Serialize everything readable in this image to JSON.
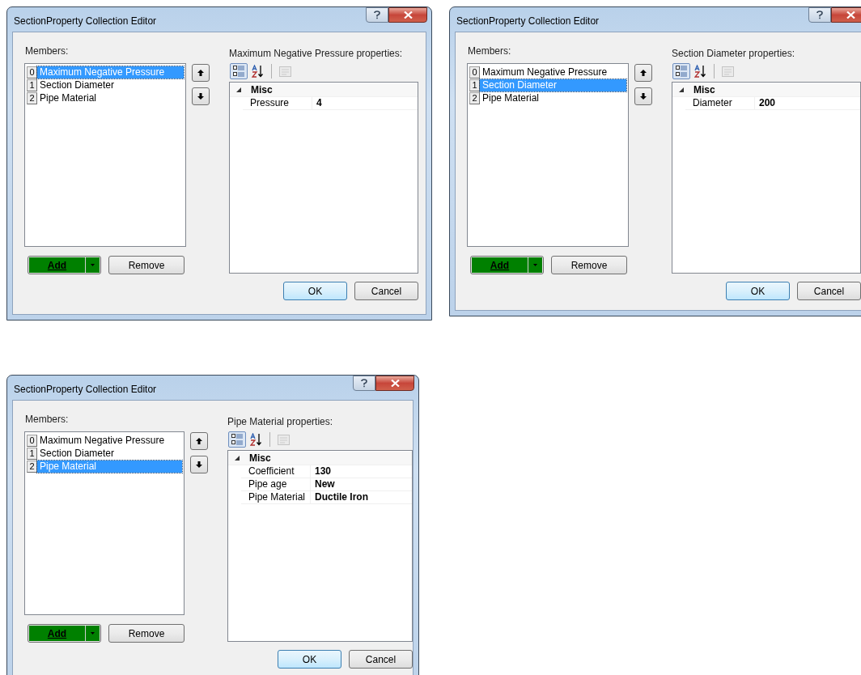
{
  "windows": [
    {
      "title": "SectionProperty Collection Editor",
      "members_label": "Members:",
      "members": [
        {
          "index": "0",
          "name": "Maximum Negative Pressure",
          "selected": true
        },
        {
          "index": "1",
          "name": "Section Diameter",
          "selected": false
        },
        {
          "index": "2",
          "name": "Pipe Material",
          "selected": false
        }
      ],
      "properties_label": "Maximum Negative Pressure properties:",
      "grid": {
        "category": "Misc",
        "expanded": true,
        "rows": [
          {
            "name": "Pressure",
            "value": "4"
          }
        ]
      },
      "add_button": "Add",
      "remove_button": "Remove",
      "ok_button": "OK",
      "cancel_button": "Cancel"
    },
    {
      "title": "SectionProperty Collection Editor",
      "members_label": "Members:",
      "members": [
        {
          "index": "0",
          "name": "Maximum Negative Pressure",
          "selected": false
        },
        {
          "index": "1",
          "name": "Section Diameter",
          "selected": true
        },
        {
          "index": "2",
          "name": "Pipe Material",
          "selected": false
        }
      ],
      "properties_label": "Section Diameter properties:",
      "grid": {
        "category": "Misc",
        "expanded": true,
        "rows": [
          {
            "name": "Diameter",
            "value": "200"
          }
        ]
      },
      "add_button": "Add",
      "remove_button": "Remove",
      "ok_button": "OK",
      "cancel_button": "Cancel"
    },
    {
      "title": "SectionProperty Collection Editor",
      "members_label": "Members:",
      "members": [
        {
          "index": "0",
          "name": "Maximum Negative Pressure",
          "selected": false
        },
        {
          "index": "1",
          "name": "Section Diameter",
          "selected": false
        },
        {
          "index": "2",
          "name": "Pipe Material",
          "selected": true
        }
      ],
      "properties_label": "Pipe Material properties:",
      "grid": {
        "category": "Misc",
        "expanded": true,
        "rows": [
          {
            "name": "Coefficient",
            "value": "130"
          },
          {
            "name": "Pipe age",
            "value": "New"
          },
          {
            "name": "Pipe Material",
            "value": "Ductile Iron"
          }
        ]
      },
      "add_button": "Add",
      "remove_button": "Remove",
      "ok_button": "OK",
      "cancel_button": "Cancel"
    }
  ]
}
